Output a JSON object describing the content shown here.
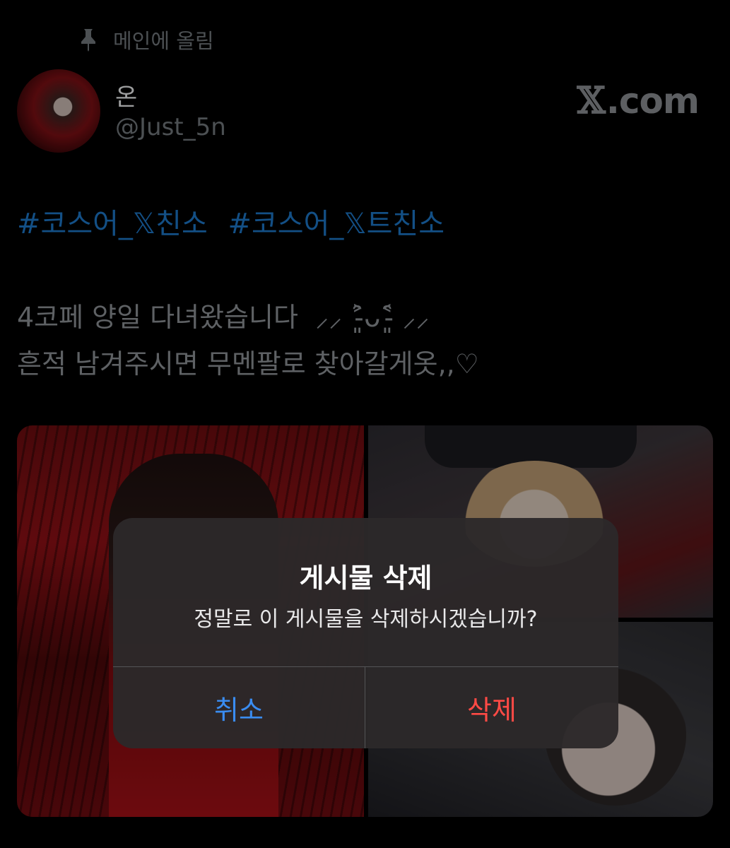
{
  "pinned": {
    "icon": "pin-icon",
    "label": "메인에 올림"
  },
  "user": {
    "name": "온",
    "handle": "@Just_5n",
    "avatar": "avatar-photo"
  },
  "brand": {
    "glyph": "𝕏",
    "suffix": ".com"
  },
  "tweet": {
    "hashtags": [
      "#코스어_𝕏친소",
      "#코스어_𝕏트친소"
    ],
    "lines": [
      "4코페 양일 다녀왔습니다 ‎ ⸝⸝ ˃̵͈̑ᴗ˂̵͈̑ ⸝⸝ ",
      "흔적 남겨주시면 무멘팔로 찾아갈게옷,,♡"
    ]
  },
  "alert": {
    "title": "게시물 삭제",
    "message": "정말로 이 게시물을 삭제하시겠습니까?",
    "cancel_label": "취소",
    "delete_label": "삭제"
  },
  "colors": {
    "hashtag": "#1d75c4",
    "cancel": "#3a8cf0",
    "delete": "#ff4a45"
  }
}
